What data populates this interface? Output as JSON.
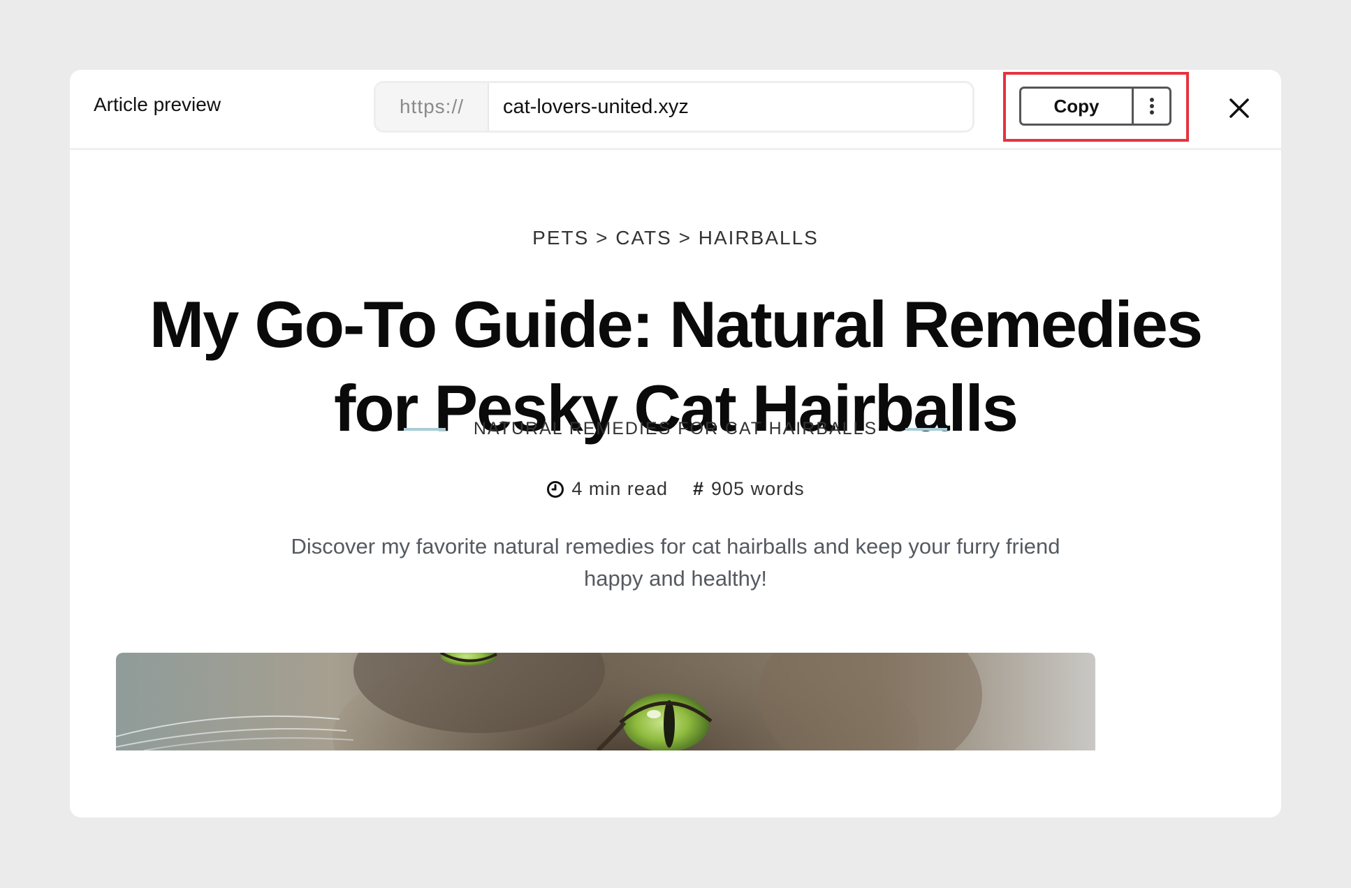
{
  "modal": {
    "title": "Article preview",
    "url_scheme": "https://",
    "url_value": "cat-lovers-united.xyz",
    "copy_label": "Copy",
    "more_icon": "kebab-menu-icon",
    "close_icon": "close-icon"
  },
  "article": {
    "breadcrumb": [
      "PETS",
      ">",
      "CATS",
      ">",
      "HAIRBALLS"
    ],
    "headline": "My Go-To Guide: Natural Remedies for Pesky Cat Hairballs",
    "subtitle": "NATURAL REMEDIES FOR CAT HAIRBALLS",
    "read_time": "4 min read",
    "read_time_icon": "clock-icon",
    "word_count": "905 words",
    "word_count_icon": "hash-icon",
    "word_count_glyph": "#",
    "summary": "Discover my favorite natural remedies for cat hairballs and keep your furry friend happy and healthy!",
    "hero_image": "cat-closeup-photo"
  },
  "colors": {
    "background": "#ebebeb",
    "highlight": "#e5333f",
    "rule": "#a9ccd6"
  }
}
